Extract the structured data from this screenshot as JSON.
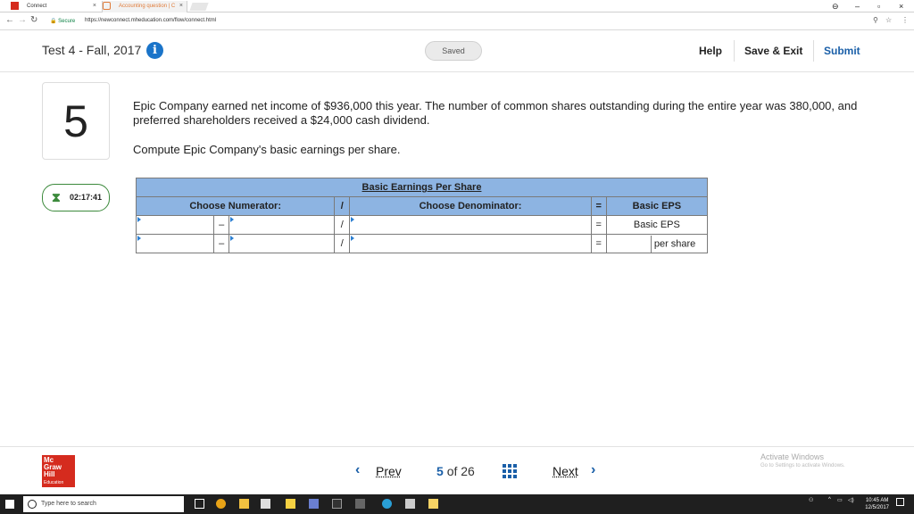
{
  "browser": {
    "tabs": [
      {
        "label": "Connect",
        "close": "×"
      },
      {
        "label": "Accounting question | C",
        "close": "×"
      }
    ],
    "window_controls": {
      "account": "⊖",
      "minimize": "–",
      "maximize": "▫",
      "close": "×"
    },
    "secure_label": "Secure",
    "url": "https://newconnect.mheducation.com/flow/connect.html"
  },
  "header": {
    "test_title": "Test 4 - Fall, 2017",
    "saved_label": "Saved",
    "help_label": "Help",
    "save_exit_label": "Save & Exit",
    "submit_label": "Submit"
  },
  "question": {
    "number": "5",
    "text": "Epic Company earned net income of $936,000 this year. The number of common shares outstanding during the entire year was 380,000, and preferred shareholders received a $24,000 cash dividend.",
    "prompt": "Compute Epic Company's basic earnings per share."
  },
  "timer": {
    "value": "02:17:41"
  },
  "eps_table": {
    "title": "Basic Earnings Per Share",
    "headers": {
      "numerator": "Choose Numerator:",
      "divide": "/",
      "denominator": "Choose Denominator:",
      "equals": "=",
      "result": "Basic EPS"
    },
    "row1": {
      "minus": "–",
      "divide": "/",
      "equals": "=",
      "result": "Basic EPS"
    },
    "row2": {
      "minus": "–",
      "divide": "/",
      "equals": "=",
      "result": "per share"
    }
  },
  "footer": {
    "logo_lines": [
      "Mc",
      "Graw",
      "Hill",
      "Education"
    ],
    "prev_label": "Prev",
    "next_label": "Next",
    "current_page": "5",
    "of_label": "of",
    "total_pages": "26",
    "activate_title": "Activate Windows",
    "activate_sub": "Go to Settings to activate Windows."
  },
  "taskbar": {
    "search_placeholder": "Type here to search",
    "time": "10:45 AM",
    "date": "12/5/2017"
  }
}
